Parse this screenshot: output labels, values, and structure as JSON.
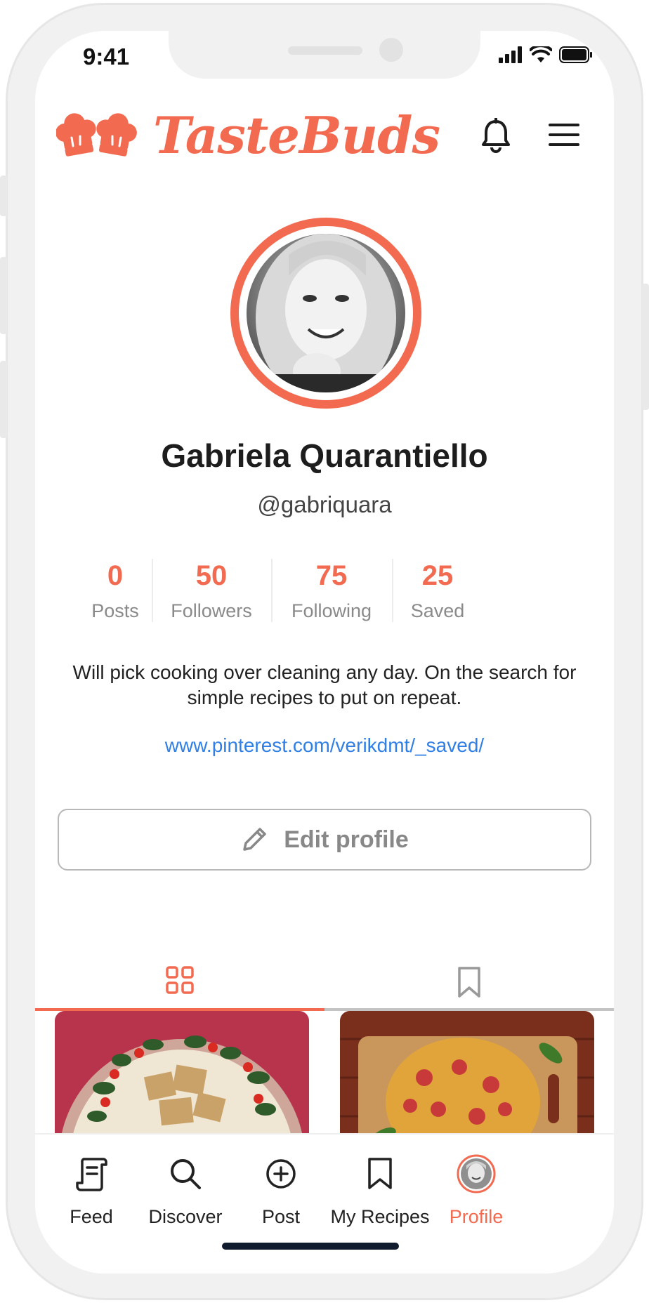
{
  "colors": {
    "accent": "#f26a50",
    "link": "#2f7fe6",
    "text": "#222222",
    "muted": "#8a8a8a"
  },
  "status_bar": {
    "time": "9:41",
    "icons": [
      "signal-icon",
      "wifi-icon",
      "battery-icon"
    ]
  },
  "header": {
    "app_name": "TasteBuds",
    "icons": [
      "chef-hat-logo",
      "bell-icon",
      "menu-icon"
    ]
  },
  "profile": {
    "name": "Gabriela Quarantiello",
    "handle": "@gabriquara",
    "bio": "Will pick cooking over cleaning any day. On the search for simple recipes to put on repeat.",
    "link": "www.pinterest.com/verikdmt/_saved/"
  },
  "stats": [
    {
      "value": "0",
      "label": "Posts"
    },
    {
      "value": "50",
      "label": "Followers"
    },
    {
      "value": "75",
      "label": "Following"
    },
    {
      "value": "25",
      "label": "Saved"
    }
  ],
  "edit_button": {
    "label": "Edit profile",
    "icon": "pencil-icon"
  },
  "tabs": [
    {
      "icon": "grid-icon",
      "active": true
    },
    {
      "icon": "bookmark-icon",
      "active": false
    }
  ],
  "grid": [
    {
      "content": "flatbread-dish-photo"
    },
    {
      "content": "pizza-board-photo"
    }
  ],
  "bottom_nav": [
    {
      "label": "Feed",
      "icon": "feed-icon",
      "active": false
    },
    {
      "label": "Discover",
      "icon": "search-icon",
      "active": false
    },
    {
      "label": "Post",
      "icon": "plus-circle-icon",
      "active": false
    },
    {
      "label": "My Recipes",
      "icon": "bookmark-icon",
      "active": false
    },
    {
      "label": "Profile",
      "icon": "avatar-icon",
      "active": true
    }
  ]
}
